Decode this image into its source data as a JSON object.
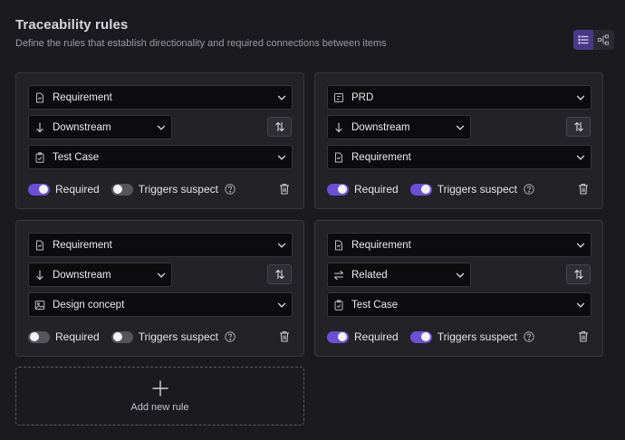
{
  "header": {
    "title": "Traceability rules",
    "subtitle": "Define the rules that establish directionality and required connections between items"
  },
  "view_toggle": {
    "active": "list"
  },
  "labels": {
    "required": "Required",
    "triggers_suspect": "Triggers suspect",
    "add_new_rule": "Add new rule"
  },
  "rules": [
    {
      "source": "Requirement",
      "source_icon": "requirement-icon",
      "direction": "Downstream",
      "direction_icon": "arrow-down-icon",
      "target": "Test Case",
      "target_icon": "test-case-icon",
      "required": true,
      "triggers_suspect": false
    },
    {
      "source": "PRD",
      "source_icon": "prd-icon",
      "direction": "Downstream",
      "direction_icon": "arrow-down-icon",
      "target": "Requirement",
      "target_icon": "requirement-icon",
      "required": true,
      "triggers_suspect": true
    },
    {
      "source": "Requirement",
      "source_icon": "requirement-icon",
      "direction": "Downstream",
      "direction_icon": "arrow-down-icon",
      "target": "Design concept",
      "target_icon": "image-icon",
      "required": false,
      "triggers_suspect": false
    },
    {
      "source": "Requirement",
      "source_icon": "requirement-icon",
      "direction": "Related",
      "direction_icon": "related-arrows-icon",
      "target": "Test Case",
      "target_icon": "test-case-icon",
      "required": true,
      "triggers_suspect": true
    }
  ],
  "colors": {
    "accent": "#6d4fd6",
    "background": "#1b1b1f",
    "card": "#232327"
  }
}
